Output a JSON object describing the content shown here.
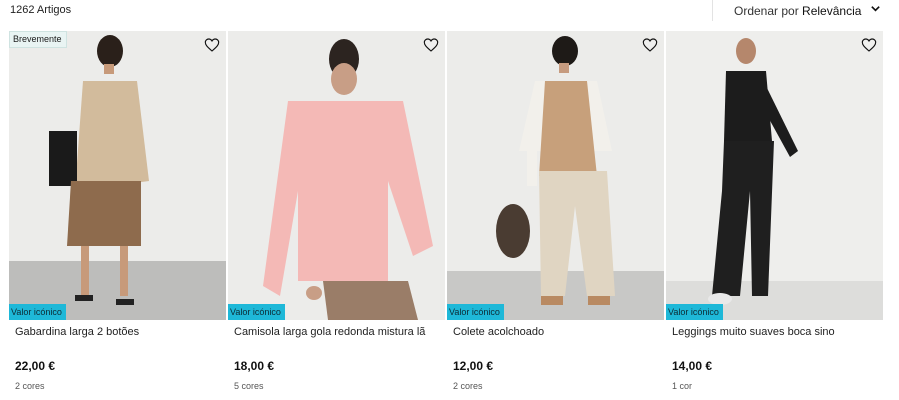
{
  "header": {
    "count": "1262 Artigos",
    "sort_label": "Ordenar por ",
    "sort_value": "Relevância"
  },
  "products": [
    {
      "name": "Gabardina larga 2 botões",
      "price": "22,00 €",
      "colors": "2 cores",
      "badge_top": "Brevemente",
      "badge_bottom": "Valor icónico"
    },
    {
      "name": "Camisola larga gola redonda mistura lã",
      "price": "18,00 €",
      "colors": "5 cores",
      "badge_bottom": "Valor icónico"
    },
    {
      "name": "Colete acolchoado",
      "price": "12,00 €",
      "colors": "2 cores",
      "badge_bottom": "Valor icónico"
    },
    {
      "name": "Leggings muito suaves boca sino",
      "price": "14,00 €",
      "colors": "1 cor",
      "badge_bottom": "Valor icónico"
    }
  ],
  "icons": {
    "favorite": "heart-outline-icon",
    "sort": "chevron-down-icon"
  },
  "colors": {
    "badge_accent": "#1eb8d8",
    "badge_soon": "#e9f4f3"
  }
}
